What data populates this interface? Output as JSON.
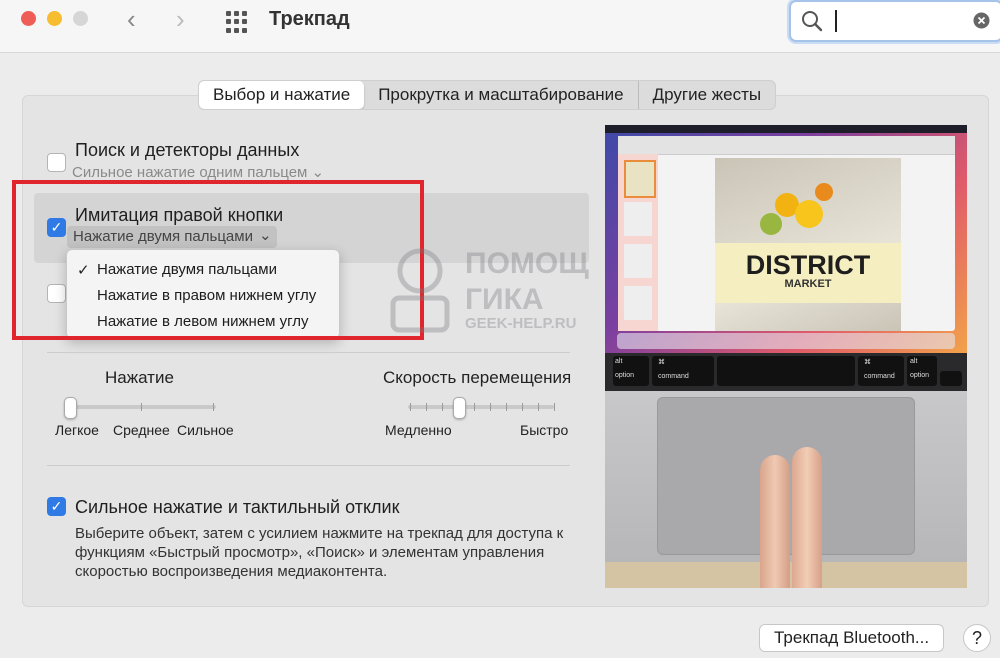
{
  "window": {
    "title": "Трекпад"
  },
  "search": {
    "value": ""
  },
  "tabs": [
    {
      "label": "Выбор и нажатие",
      "active": true
    },
    {
      "label": "Прокрутка и масштабирование",
      "active": false
    },
    {
      "label": "Другие жесты",
      "active": false
    }
  ],
  "options": {
    "lookup": {
      "label": "Поиск и детекторы данных",
      "sub": "Сильное нажатие одним пальцем",
      "checked": false
    },
    "secondary_click": {
      "label": "Имитация правой кнопки",
      "selected": "Нажатие двумя пальцами",
      "checked": true
    },
    "force_click": {
      "label": "Сильное нажатие и тактильный отклик",
      "checked": true,
      "description": "Выберите объект, затем с усилием нажмите на трекпад для доступа к функциям «Быстрый просмотр», «Поиск» и элементам управления скоростью воспроизведения медиаконтента."
    }
  },
  "dropdown": {
    "items": [
      {
        "label": "Нажатие двумя пальцами",
        "checked": true
      },
      {
        "label": "Нажатие в правом нижнем углу",
        "checked": false
      },
      {
        "label": "Нажатие в левом нижнем углу",
        "checked": false
      }
    ]
  },
  "click_slider": {
    "title": "Нажатие",
    "labels": [
      "Легкое",
      "Среднее",
      "Сильное"
    ],
    "value": 0
  },
  "speed_slider": {
    "title": "Скорость перемещения",
    "labels": [
      "Медленно",
      "Быстро"
    ],
    "value": 0.35
  },
  "preview": {
    "poster_title": "DISTRICT",
    "poster_subtitle": "MARKET",
    "key_alt": "alt",
    "key_option": "option",
    "key_cmd": "⌘",
    "key_command": "command"
  },
  "watermark": {
    "line1": "ПОМОЩ",
    "line2": "ГИКА",
    "line3": "GEEK-HELP.RU"
  },
  "footer": {
    "bluetooth_button": "Трекпад Bluetooth...",
    "help": "?"
  },
  "colors": {
    "accent": "#2f7ae5",
    "highlight_box": "#e0252c"
  }
}
